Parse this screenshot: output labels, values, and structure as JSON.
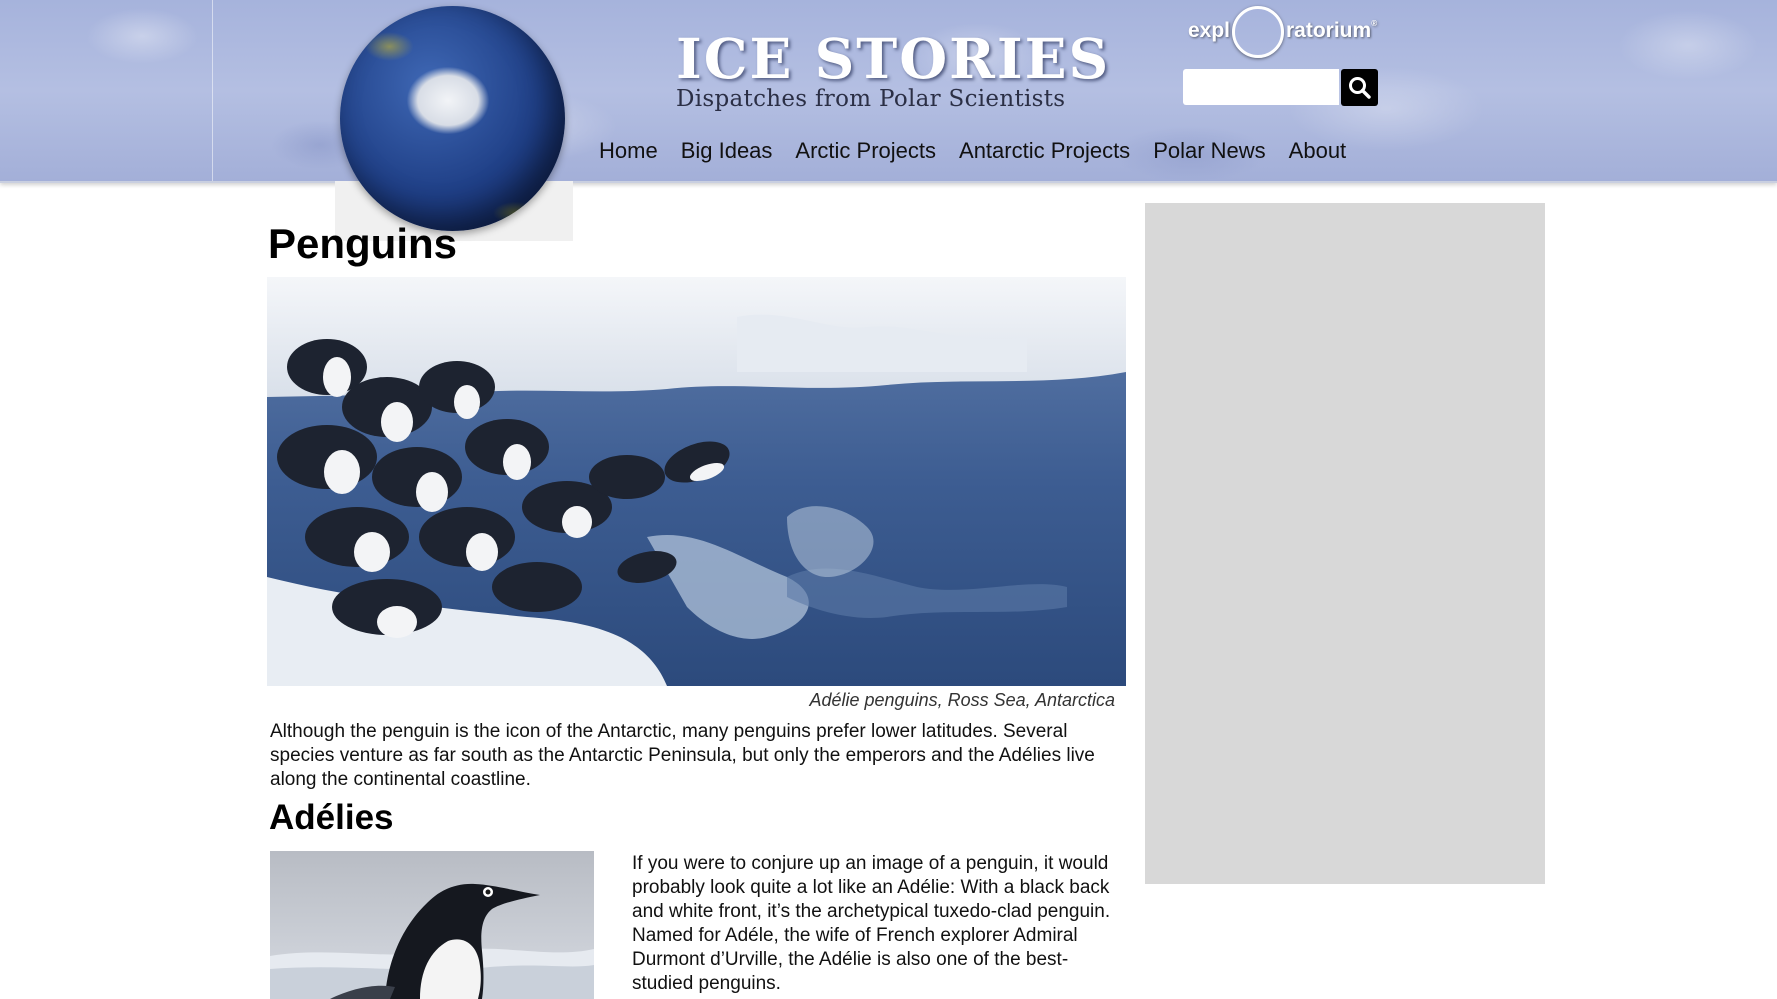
{
  "header": {
    "title": "ICE STORIES",
    "subtitle": "Dispatches from Polar Scientists",
    "logo_left": "expl",
    "logo_right": "ratorium",
    "logo_mark": "®",
    "search": {
      "placeholder": "",
      "value": ""
    },
    "search_icon": "magnifier-icon",
    "globe_icon": "antarctica-globe"
  },
  "nav": {
    "items": [
      {
        "label": "Home"
      },
      {
        "label": "Big Ideas"
      },
      {
        "label": "Arctic Projects"
      },
      {
        "label": "Antarctic Projects"
      },
      {
        "label": "Polar News"
      },
      {
        "label": "About"
      }
    ]
  },
  "main": {
    "title": "Penguins",
    "hero_caption": "Adélie penguins, Ross Sea, Antarctica",
    "intro": "Although the penguin is the icon of the Antarctic, many penguins prefer lower latitudes. Several species venture as far south as the Antarctic Peninsula, but only the emperors and the Adélies live along the continental coastline.",
    "section_heading": "Adélies",
    "section_text": "If you were to conjure up an image of a penguin, it would probably look quite a lot like an Adélie: With a black back and white front, it’s the archetypical tuxedo-clad penguin. Named for Adéle, the wife of French explorer Admiral Durmont d’Urville, the Adélie is also one of the best-studied penguins."
  },
  "colors": {
    "header_bg": "#a6b3dc",
    "sidebar_bg": "#d8d8d8",
    "search_button": "#000000"
  }
}
